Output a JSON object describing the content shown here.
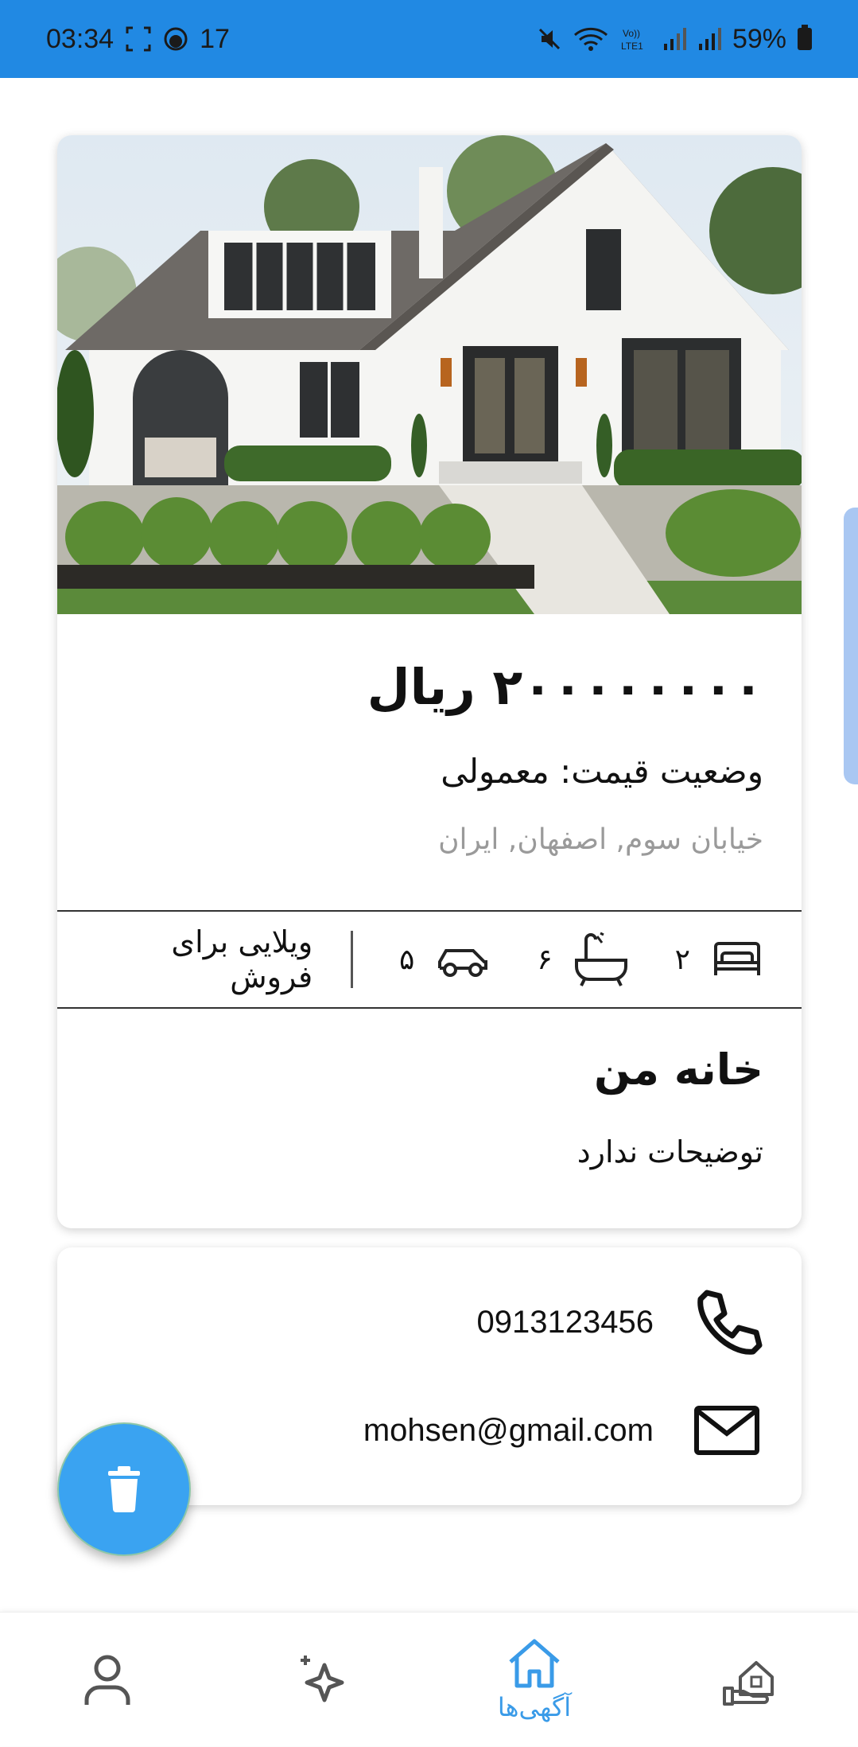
{
  "status_bar": {
    "time": "03:34",
    "notification_count": "17",
    "battery": "59%"
  },
  "listing": {
    "price": "۲۰۰۰۰۰۰۰۰ ریال",
    "price_status": "وضعیت قیمت: معمولی",
    "address": "خیابان سوم, اصفهان, ایران",
    "features": {
      "bedrooms": "۲",
      "bathrooms": "۶",
      "parking": "۵",
      "type": "ویلایی برای فروش"
    },
    "title": "خانه من",
    "description": "توضیحات ندارد"
  },
  "contact": {
    "phone": "0913123456",
    "email": "mohsen@gmail.com"
  },
  "bottom_nav": {
    "active_label": "آگهی‌ها",
    "active_color": "#3a9be8"
  },
  "icons": [
    "bed-icon",
    "bathtub-icon",
    "car-icon",
    "phone-icon",
    "mail-icon",
    "trash-icon",
    "profile-icon",
    "sparkle-icon",
    "home-icon",
    "real-estate-icon"
  ]
}
